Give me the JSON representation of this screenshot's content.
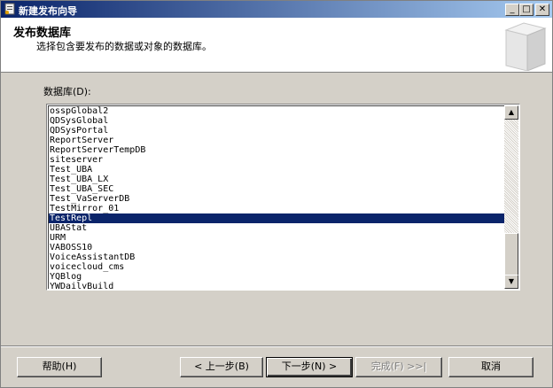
{
  "window": {
    "title": "新建发布向导"
  },
  "titlebar_buttons": {
    "minimize": "_",
    "maximize": "□",
    "close": "✕"
  },
  "header": {
    "title": "发布数据库",
    "subtitle": "选择包含要发布的数据或对象的数据库。"
  },
  "database_list": {
    "label": "数据库(D):",
    "items": [
      "osspGlobal2",
      "QDSysGlobal",
      "QDSysPortal",
      "ReportServer",
      "ReportServerTempDB",
      "siteserver",
      "Test_UBA",
      "Test_UBA_LX",
      "Test_UBA_SEC",
      "Test_VaServerDB",
      "TestMirror_01",
      "TestRepl",
      "UBAStat",
      "URM",
      "VABOSS10",
      "VoiceAssistantDB",
      "voicecloud_cms",
      "YQBlog",
      "YWDailyBuild"
    ],
    "selected": "TestRepl"
  },
  "buttons": {
    "help": "帮助(H)",
    "back": "< 上一步(B)",
    "next": "下一步(N) >",
    "finish": "完成(F) >>|",
    "cancel": "取消"
  },
  "colors": {
    "selection": "#0a246a",
    "titlebar": "#0a246a",
    "face": "#d4d0c8"
  }
}
